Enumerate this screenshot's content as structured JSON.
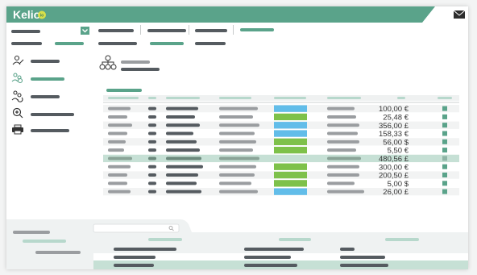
{
  "app": {
    "logo_text": "Kelio",
    "logo_mark_letter": "io"
  },
  "icons": {
    "mail": "mail-icon",
    "dropdown": "chevron-down-icon",
    "user_edit": "user-edit-icon",
    "users_settings": "users-gear-icon",
    "users_refresh": "users-refresh-icon",
    "search_zoom": "zoom-search-icon",
    "printer": "printer-icon",
    "org_chart": "org-chart-icon",
    "search": "search-icon"
  },
  "table": {
    "amounts": [
      "100,00 €",
      "25,48 €",
      "356,00 £",
      "158,33 €",
      "56,00 $",
      "5,50 €",
      "480,56 £",
      "300,00 €",
      "200,50 £",
      "5,00 $",
      "26,00 £"
    ],
    "status_colors": [
      "blue",
      "green",
      "blue",
      "blue",
      "green",
      "green",
      "green",
      "green",
      "green",
      "green",
      "blue"
    ],
    "selected_row_index": 6
  },
  "colors": {
    "teal": "#5aa38a",
    "teal_light": "#b7d8cc",
    "green": "#7ec14a",
    "blue": "#62bde9",
    "dark_placeholder": "#555b60",
    "gray_placeholder": "#9a9da0",
    "selected_row": "#c6e0d5"
  }
}
